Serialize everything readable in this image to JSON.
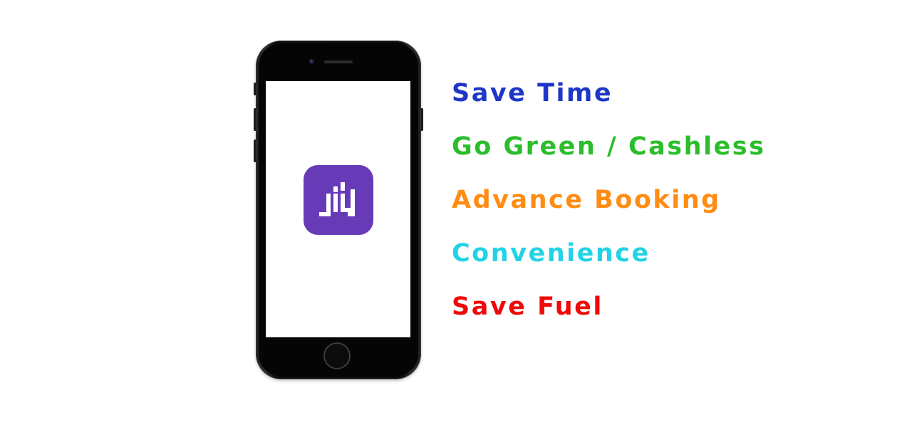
{
  "phone": {
    "app_icon": {
      "icon": "app-logo-icon",
      "background_color": "#673ab7",
      "glyph_color": "#ffffff"
    }
  },
  "features": [
    {
      "label": "Save Time",
      "color": "#1f37c8"
    },
    {
      "label": "Go Green / Cashless",
      "color": "#2bbd2b"
    },
    {
      "label": "Advance Booking",
      "color": "#ff8c13"
    },
    {
      "label": "Convenience",
      "color": "#22d3e6"
    },
    {
      "label": "Save Fuel",
      "color": "#ee0a0a"
    }
  ]
}
